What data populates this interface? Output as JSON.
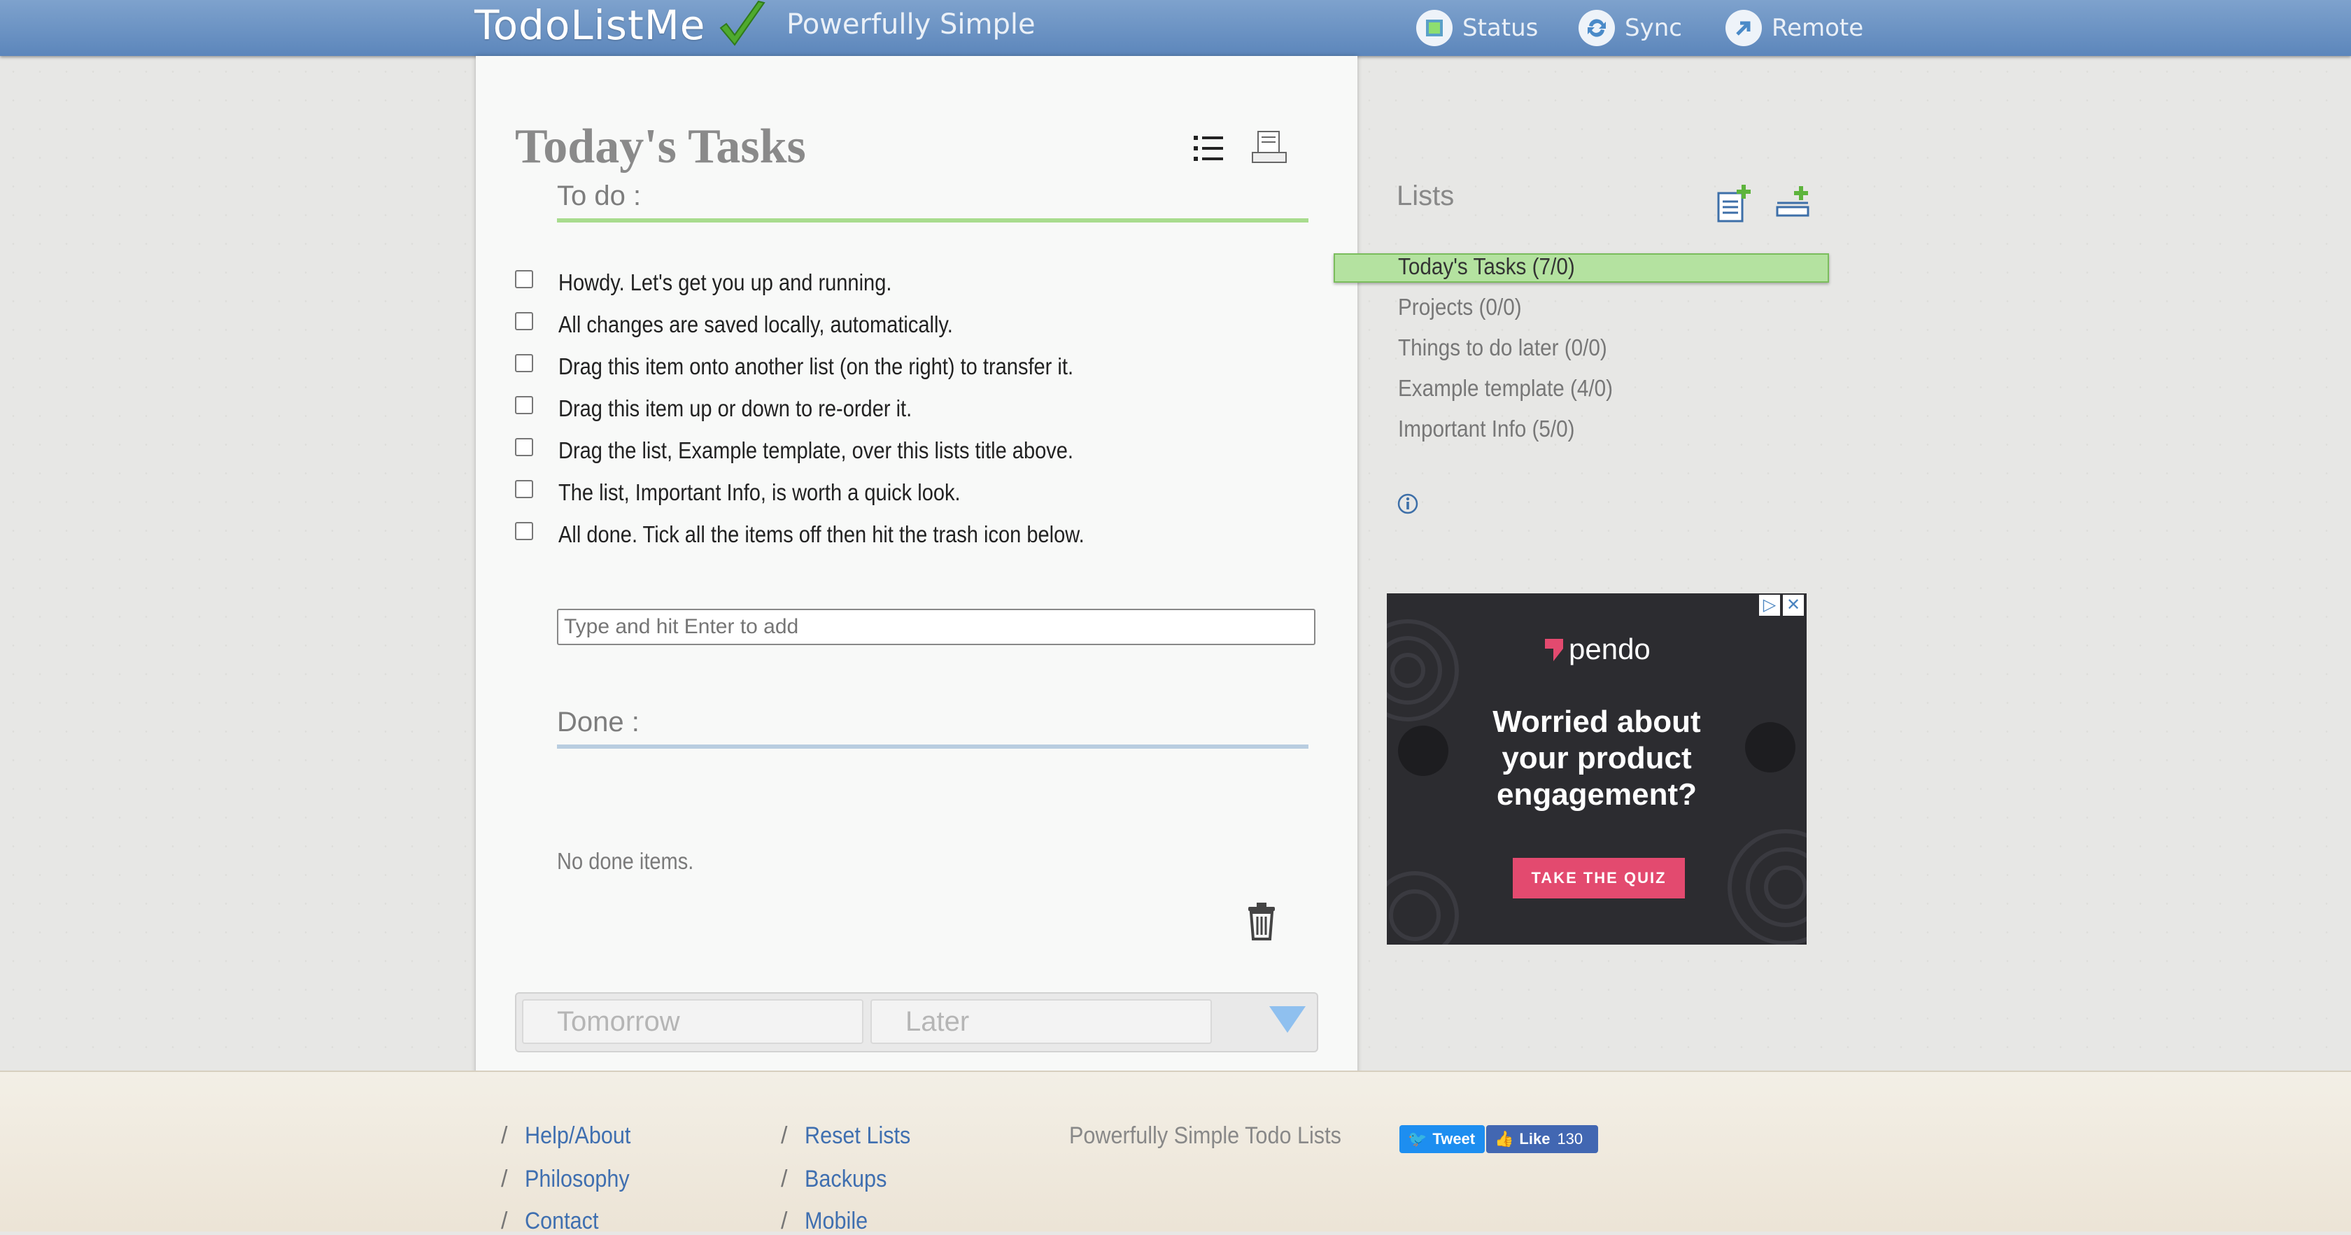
{
  "header": {
    "logo": "TodoListMe",
    "tagline": "Powerfully Simple",
    "nav": [
      {
        "label": "Status",
        "icon": "status-icon"
      },
      {
        "label": "Sync",
        "icon": "sync-icon"
      },
      {
        "label": "Remote",
        "icon": "remote-icon"
      }
    ]
  },
  "main": {
    "title": "Today's Tasks",
    "todo_heading": "To do :",
    "tasks": [
      "Howdy. Let's get you up and running.",
      "All changes are saved locally, automatically.",
      "Drag this item onto another list (on the right) to transfer it.",
      "Drag this item up or down to re-order it.",
      "Drag the list, Example template, over this lists title above.",
      "The list, Important Info, is worth a quick look.",
      "All done. Tick all the items off then hit the trash icon below."
    ],
    "add_placeholder": "Type and hit Enter to add",
    "done_heading": "Done :",
    "no_done": "No done items.",
    "tabs": [
      "Tomorrow",
      "Later"
    ]
  },
  "sidebar": {
    "title": "Lists",
    "lists": [
      "Today's Tasks (7/0)",
      "Projects (0/0)",
      "Things to do later (0/0)",
      "Example template (4/0)",
      "Important Info (5/0)"
    ],
    "selected_index": 0
  },
  "ad": {
    "brand": "pendo",
    "headline_lines": [
      "Worried about",
      "your product",
      "engagement?"
    ],
    "cta": "TAKE THE QUIZ"
  },
  "footer": {
    "col1": [
      "Help/About",
      "Philosophy",
      "Contact"
    ],
    "col2": [
      "Reset Lists",
      "Backups",
      "Mobile"
    ],
    "tagline": "Powerfully Simple Todo Lists",
    "tweet": "Tweet",
    "like": "Like",
    "like_count": "130"
  },
  "colors": {
    "header_blue": "#5c86bb",
    "todo_rule": "#a8dc8e",
    "done_rule": "#b9cde0",
    "selected_list": "#b4e2a0",
    "link": "#3f6fb0"
  }
}
